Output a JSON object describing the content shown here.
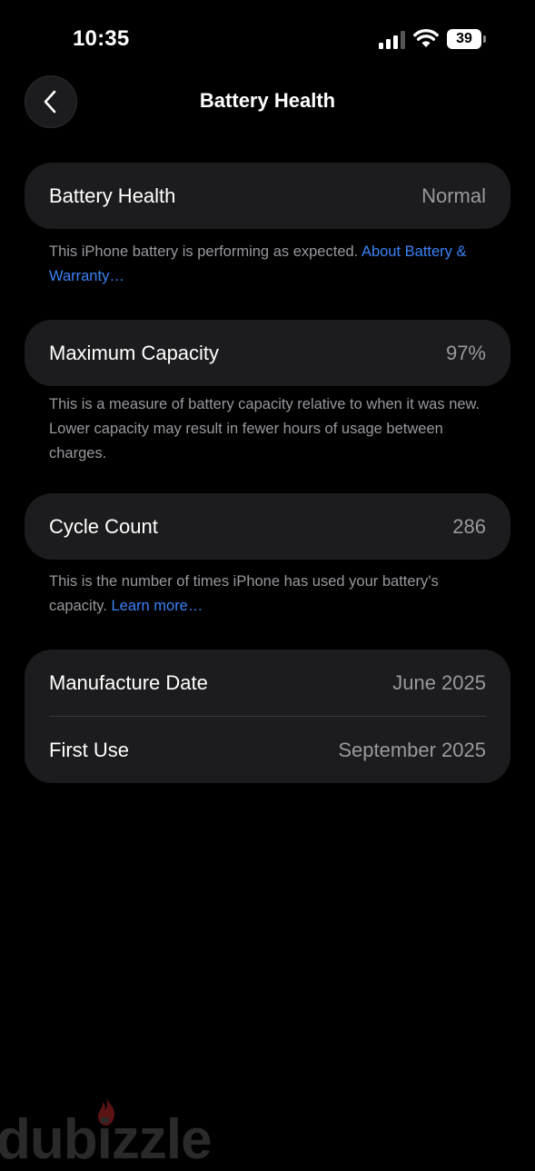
{
  "status_bar": {
    "time": "10:35",
    "battery_level": "39",
    "icons": [
      "signal-icon",
      "wifi-icon",
      "battery-icon"
    ]
  },
  "nav": {
    "title": "Battery Health",
    "back_icon": "chevron-left-icon"
  },
  "battery_health": {
    "label": "Battery Health",
    "value": "Normal",
    "note": "This iPhone battery is performing as expected.",
    "link": "About Battery & Warranty…"
  },
  "maximum_capacity": {
    "label": "Maximum Capacity",
    "value": "97%",
    "note": "This is a measure of battery capacity relative to when it was new. Lower capacity may result in fewer hours of usage between charges."
  },
  "cycle_count": {
    "label": "Cycle Count",
    "value": "286",
    "note": "This is the number of times iPhone has used your battery's capacity.",
    "link": "Learn more…"
  },
  "dates": {
    "manufacture_label": "Manufacture Date",
    "manufacture_value": "June 2025",
    "first_use_label": "First Use",
    "first_use_value": "September 2025"
  },
  "watermark": {
    "text": "dubizzle"
  },
  "colors": {
    "background": "#000000",
    "card": "#1c1c1e",
    "secondary_text": "#98989e",
    "link": "#3b82f6"
  }
}
